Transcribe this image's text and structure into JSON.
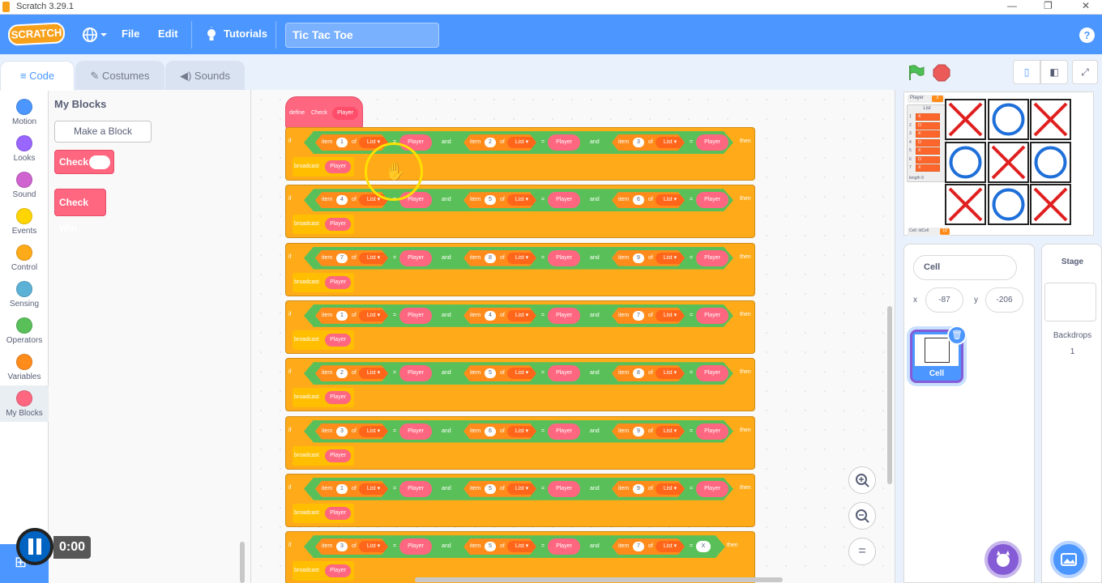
{
  "window": {
    "title": "Scratch 3.29.1",
    "minimize": "—",
    "maximize": "❐",
    "close": "✕"
  },
  "menu": {
    "logo": "SCRATCH",
    "file": "File",
    "edit": "Edit",
    "tutorials": "Tutorials",
    "project_title": "Tic Tac Toe",
    "help": "?"
  },
  "tabs": [
    {
      "label": "Code"
    },
    {
      "label": "Costumes"
    },
    {
      "label": "Sounds"
    }
  ],
  "categories": [
    {
      "label": "Motion",
      "color": "#4c97ff"
    },
    {
      "label": "Looks",
      "color": "#9966ff"
    },
    {
      "label": "Sound",
      "color": "#cf63cf"
    },
    {
      "label": "Events",
      "color": "#ffd500"
    },
    {
      "label": "Control",
      "color": "#ffab19"
    },
    {
      "label": "Sensing",
      "color": "#5cb1d6"
    },
    {
      "label": "Operators",
      "color": "#59c059"
    },
    {
      "label": "Variables",
      "color": "#ff8c1a"
    },
    {
      "label": "My Blocks",
      "color": "#ff6680"
    }
  ],
  "palette": {
    "title": "My Blocks",
    "make_block": "Make a Block",
    "blocks": [
      "Check",
      "Check Win"
    ]
  },
  "script": {
    "define_label": "define",
    "define_name": "Check",
    "define_param": "Player",
    "words": {
      "if": "if",
      "item": "item",
      "of": "of",
      "list": "List ▾",
      "eq": "=",
      "and": "and",
      "then": "then",
      "broadcast": "broadcast",
      "player": "Player"
    },
    "conditions": [
      {
        "items": [
          "1",
          "2",
          "3"
        ],
        "last": "Player"
      },
      {
        "items": [
          "4",
          "5",
          "6"
        ],
        "last": "Player"
      },
      {
        "items": [
          "7",
          "8",
          "9"
        ],
        "last": "Player"
      },
      {
        "items": [
          "1",
          "4",
          "7"
        ],
        "last": "Player"
      },
      {
        "items": [
          "2",
          "5",
          "8"
        ],
        "last": "Player"
      },
      {
        "items": [
          "3",
          "6",
          "9"
        ],
        "last": "Player"
      },
      {
        "items": [
          "1",
          "5",
          "9"
        ],
        "last": "Player"
      },
      {
        "items": [
          "3",
          "5",
          "7"
        ],
        "last": "X"
      }
    ]
  },
  "stage_monitors": {
    "player_label": "Player",
    "player_value": "X",
    "list_title": "List",
    "list_items": [
      {
        "i": "1",
        "v": "X"
      },
      {
        "i": "2",
        "v": "O"
      },
      {
        "i": "3",
        "v": "X"
      },
      {
        "i": "4",
        "v": "O"
      },
      {
        "i": "5",
        "v": "X"
      },
      {
        "i": "6",
        "v": "O"
      },
      {
        "i": "7",
        "v": "X"
      }
    ],
    "list_footer": "length 9",
    "cell_label": "Cell: IdCell",
    "cell_value": "10"
  },
  "board": [
    "X",
    "O",
    "X",
    "O",
    "X",
    "O",
    "X",
    "O",
    "X"
  ],
  "sprite_pane": {
    "sprite_name": "Cell",
    "x_label": "x",
    "x_value": "-87",
    "y_label": "y",
    "y_value": "-206",
    "thumb_label": "Cell"
  },
  "stage_pane": {
    "title": "Stage",
    "backdrops_label": "Backdrops",
    "backdrops_count": "1"
  },
  "zoom": {
    "in": "+",
    "out": "−",
    "reset": "="
  },
  "video": {
    "time": "0:00"
  }
}
